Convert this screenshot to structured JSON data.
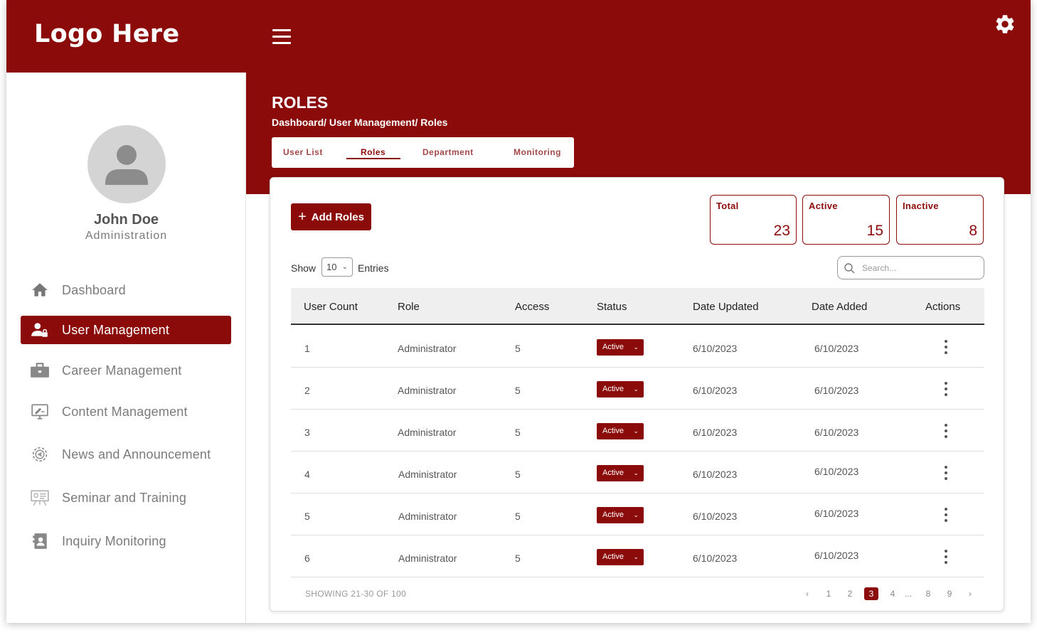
{
  "brand": {
    "logo_text": "Logo Here",
    "primary_color": "#8b0a0a"
  },
  "user": {
    "name": "John Doe",
    "role": "Administration"
  },
  "sidebar": {
    "items": [
      {
        "label": "Dashboard",
        "icon": "home-icon",
        "active": false
      },
      {
        "label": "User Management",
        "icon": "user-lock-icon",
        "active": true
      },
      {
        "label": "Career Management",
        "icon": "briefcase-icon",
        "active": false
      },
      {
        "label": "Content Management",
        "icon": "monitor-edit-icon",
        "active": false
      },
      {
        "label": "News and Announcement",
        "icon": "gear-megaphone-icon",
        "active": false
      },
      {
        "label": "Seminar and Training",
        "icon": "presentation-board-icon",
        "active": false
      },
      {
        "label": "Inquiry Monitoring",
        "icon": "contact-book-icon",
        "active": false
      }
    ]
  },
  "header": {
    "menu_icon": "hamburger-icon",
    "settings_icon": "gear-icon"
  },
  "page": {
    "title": "ROLES",
    "breadcrumb": "Dashboard/ User Management/ Roles"
  },
  "tabs": [
    {
      "label": "User List",
      "active": false
    },
    {
      "label": "Roles",
      "active": true
    },
    {
      "label": "Department",
      "active": false
    },
    {
      "label": "Monitoring",
      "active": false
    }
  ],
  "toolbar": {
    "add_label": "Add Roles"
  },
  "stats": [
    {
      "label": "Total",
      "value": "23"
    },
    {
      "label": "Active",
      "value": "15"
    },
    {
      "label": "Inactive",
      "value": "8"
    }
  ],
  "entries": {
    "show_label": "Show",
    "value": "10",
    "suffix": "Entries"
  },
  "search": {
    "placeholder": "Search..."
  },
  "table": {
    "columns": [
      "User Count",
      "Role",
      "Access",
      "Status",
      "Date Updated",
      "Date Added",
      "Actions"
    ],
    "rows": [
      {
        "count": "1",
        "role": "Administrator",
        "access": "5",
        "status": "Active",
        "updated": "6/10/2023",
        "added": "6/10/2023"
      },
      {
        "count": "2",
        "role": "Administrator",
        "access": "5",
        "status": "Active",
        "updated": "6/10/2023",
        "added": "6/10/2023"
      },
      {
        "count": "3",
        "role": "Administrator",
        "access": "5",
        "status": "Active",
        "updated": "6/10/2023",
        "added": "6/10/2023"
      },
      {
        "count": "4",
        "role": "Administrator",
        "access": "5",
        "status": "Active",
        "updated": "6/10/2023",
        "added": "6/10/2023"
      },
      {
        "count": "5",
        "role": "Administrator",
        "access": "5",
        "status": "Active",
        "updated": "6/10/2023",
        "added": "6/10/2023"
      },
      {
        "count": "6",
        "role": "Administrator",
        "access": "5",
        "status": "Active",
        "updated": "6/10/2023",
        "added": "6/10/2023"
      }
    ]
  },
  "pagination": {
    "info": "SHOWING 21-30 OF 100",
    "prev": "‹",
    "next": "›",
    "pages": [
      "1",
      "2",
      "3",
      "4",
      "...",
      "8",
      "9"
    ],
    "current": "3"
  }
}
